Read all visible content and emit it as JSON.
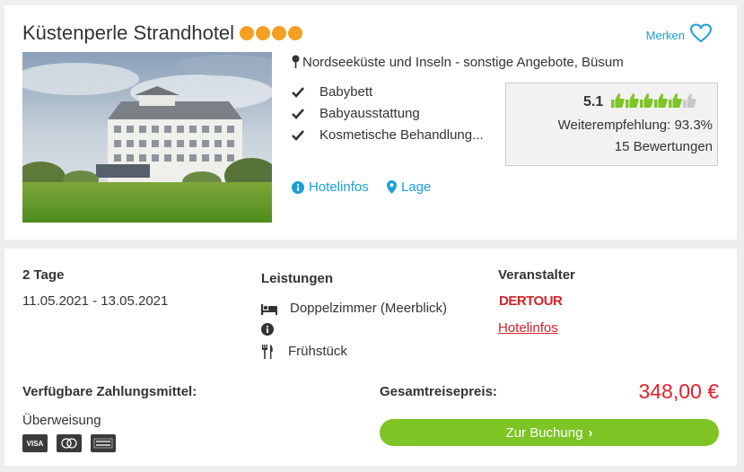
{
  "hotel": {
    "name": "Küstenperle Strandhotel",
    "star_count": 4,
    "merken_label": "Merken",
    "region": "Nordseeküste und Inseln - sonstige Angebote, Büsum",
    "features": [
      "Babybett",
      "Babyausstattung",
      "Kosmetische Behandlung..."
    ],
    "rating": {
      "score": "5.1",
      "thumbs_filled": 5,
      "thumbs_total": 6,
      "recommendation": "Weiterempfehlung: 93.3%",
      "reviews": "15 Bewertungen"
    },
    "links": {
      "hotelinfos": "Hotelinfos",
      "lage": "Lage"
    }
  },
  "offer": {
    "duration": "2 Tage",
    "dates": "11.05.2021 - 13.05.2021",
    "services_title": "Leistungen",
    "room": "Doppelzimmer (Meerblick)",
    "meal": "Frühstück",
    "operator_title": "Veranstalter",
    "operator_logo_text": "DERTOUR",
    "operator_link": "Hotelinfos",
    "payment_title": "Verfügbare Zahlungsmittel:",
    "payment_method": "Überweisung",
    "payment_cards": [
      "VISA",
      "Mastercard",
      "American Express"
    ],
    "total_label": "Gesamtreisepreis:",
    "price": "348,00 €",
    "book_label": "Zur Buchung"
  },
  "colors": {
    "accent_blue": "#1a9fd8",
    "star_orange": "#f5a023",
    "thumb_green": "#7dc424",
    "price_red": "#e3202a",
    "button_green": "#7dc424",
    "operator_red": "#d2232a"
  }
}
